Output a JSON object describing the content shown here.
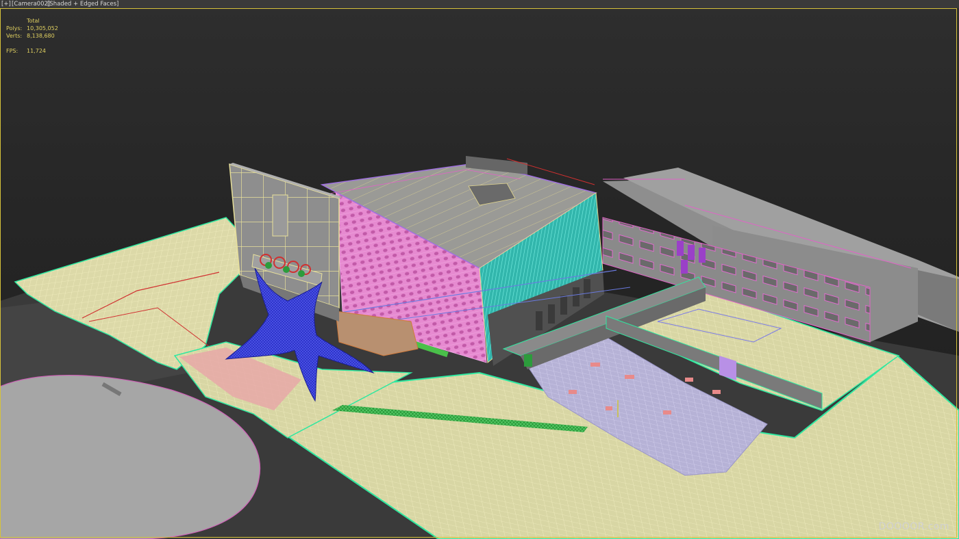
{
  "viewport": {
    "menu_label": "[+]",
    "camera_label": "[Camera002]",
    "shading_label": "[Shaded + Edged Faces]"
  },
  "stats": {
    "header": "Total",
    "polys_label": "Polys:",
    "polys_value": "10,305,052",
    "verts_label": "Verts:",
    "verts_value": "8,138,680",
    "fps_label": "FPS:",
    "fps_value": "11,724"
  },
  "watermark": "DOOOOR.com",
  "colors": {
    "viewport_border": "#d6c23a",
    "stats_text": "#e0d060",
    "ground_wire": "#e8e4a8",
    "building_gray": "#8c8c8c",
    "facade_pink": "#e68ad0",
    "facade_cyan": "#40d8c8",
    "sculpture_blue": "#2a30c8",
    "edge_green": "#28e088"
  }
}
